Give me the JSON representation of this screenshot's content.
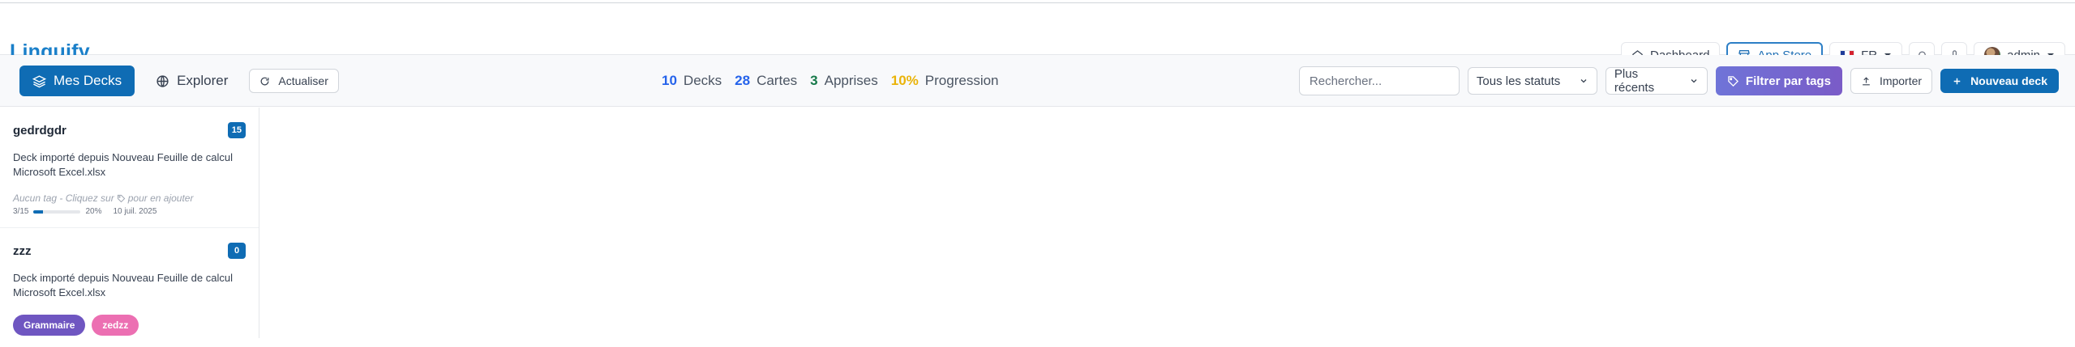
{
  "app": {
    "title": "Linguify"
  },
  "header": {
    "dashboard_label": "Dashboard",
    "app_store_label": "App Store",
    "language_label": "FR",
    "user_label": "admin"
  },
  "toolbar": {
    "my_decks_label": "Mes Decks",
    "explore_label": "Explorer",
    "refresh_label": "Actualiser",
    "stats": [
      {
        "value": "10",
        "label": "Decks",
        "color": "#2563eb"
      },
      {
        "value": "28",
        "label": "Cartes",
        "color": "#2563eb"
      },
      {
        "value": "3",
        "label": "Apprises",
        "color": "#16794a"
      },
      {
        "value": "10%",
        "label": "Progression",
        "color": "#eab308"
      }
    ],
    "search_placeholder": "Rechercher...",
    "status_filter": "Tous les statuts",
    "sort_filter": "Plus récents",
    "filter_tags_label": "Filtrer par tags",
    "import_label": "Importer",
    "new_deck_label": "Nouveau deck"
  },
  "decks": [
    {
      "name": "gedrdgdr",
      "count": "15",
      "description": "Deck importé depuis Nouveau Feuille de calcul Microsoft Excel.xlsx",
      "hint_before": "Aucun tag - Cliquez sur",
      "hint_after": "pour en ajouter",
      "progress_text": "3/15",
      "progress_percent": "20%",
      "progress_fraction": 0.2,
      "date": "10 juil. 2025"
    },
    {
      "name": "zzz",
      "count": "0",
      "description": "Deck importé depuis Nouveau Feuille de calcul Microsoft Excel.xlsx",
      "tags": [
        {
          "label": "Grammaire",
          "color": "#6f56c1"
        },
        {
          "label": "zedzz",
          "color": "#ec6fb2"
        }
      ]
    }
  ],
  "icons": [
    "home-icon",
    "store-icon",
    "flag-fr-icon",
    "chevron-down-icon",
    "bell-icon",
    "mic-icon",
    "layers-icon",
    "globe-icon",
    "refresh-icon",
    "tag-icon",
    "upload-icon",
    "plus-icon"
  ]
}
